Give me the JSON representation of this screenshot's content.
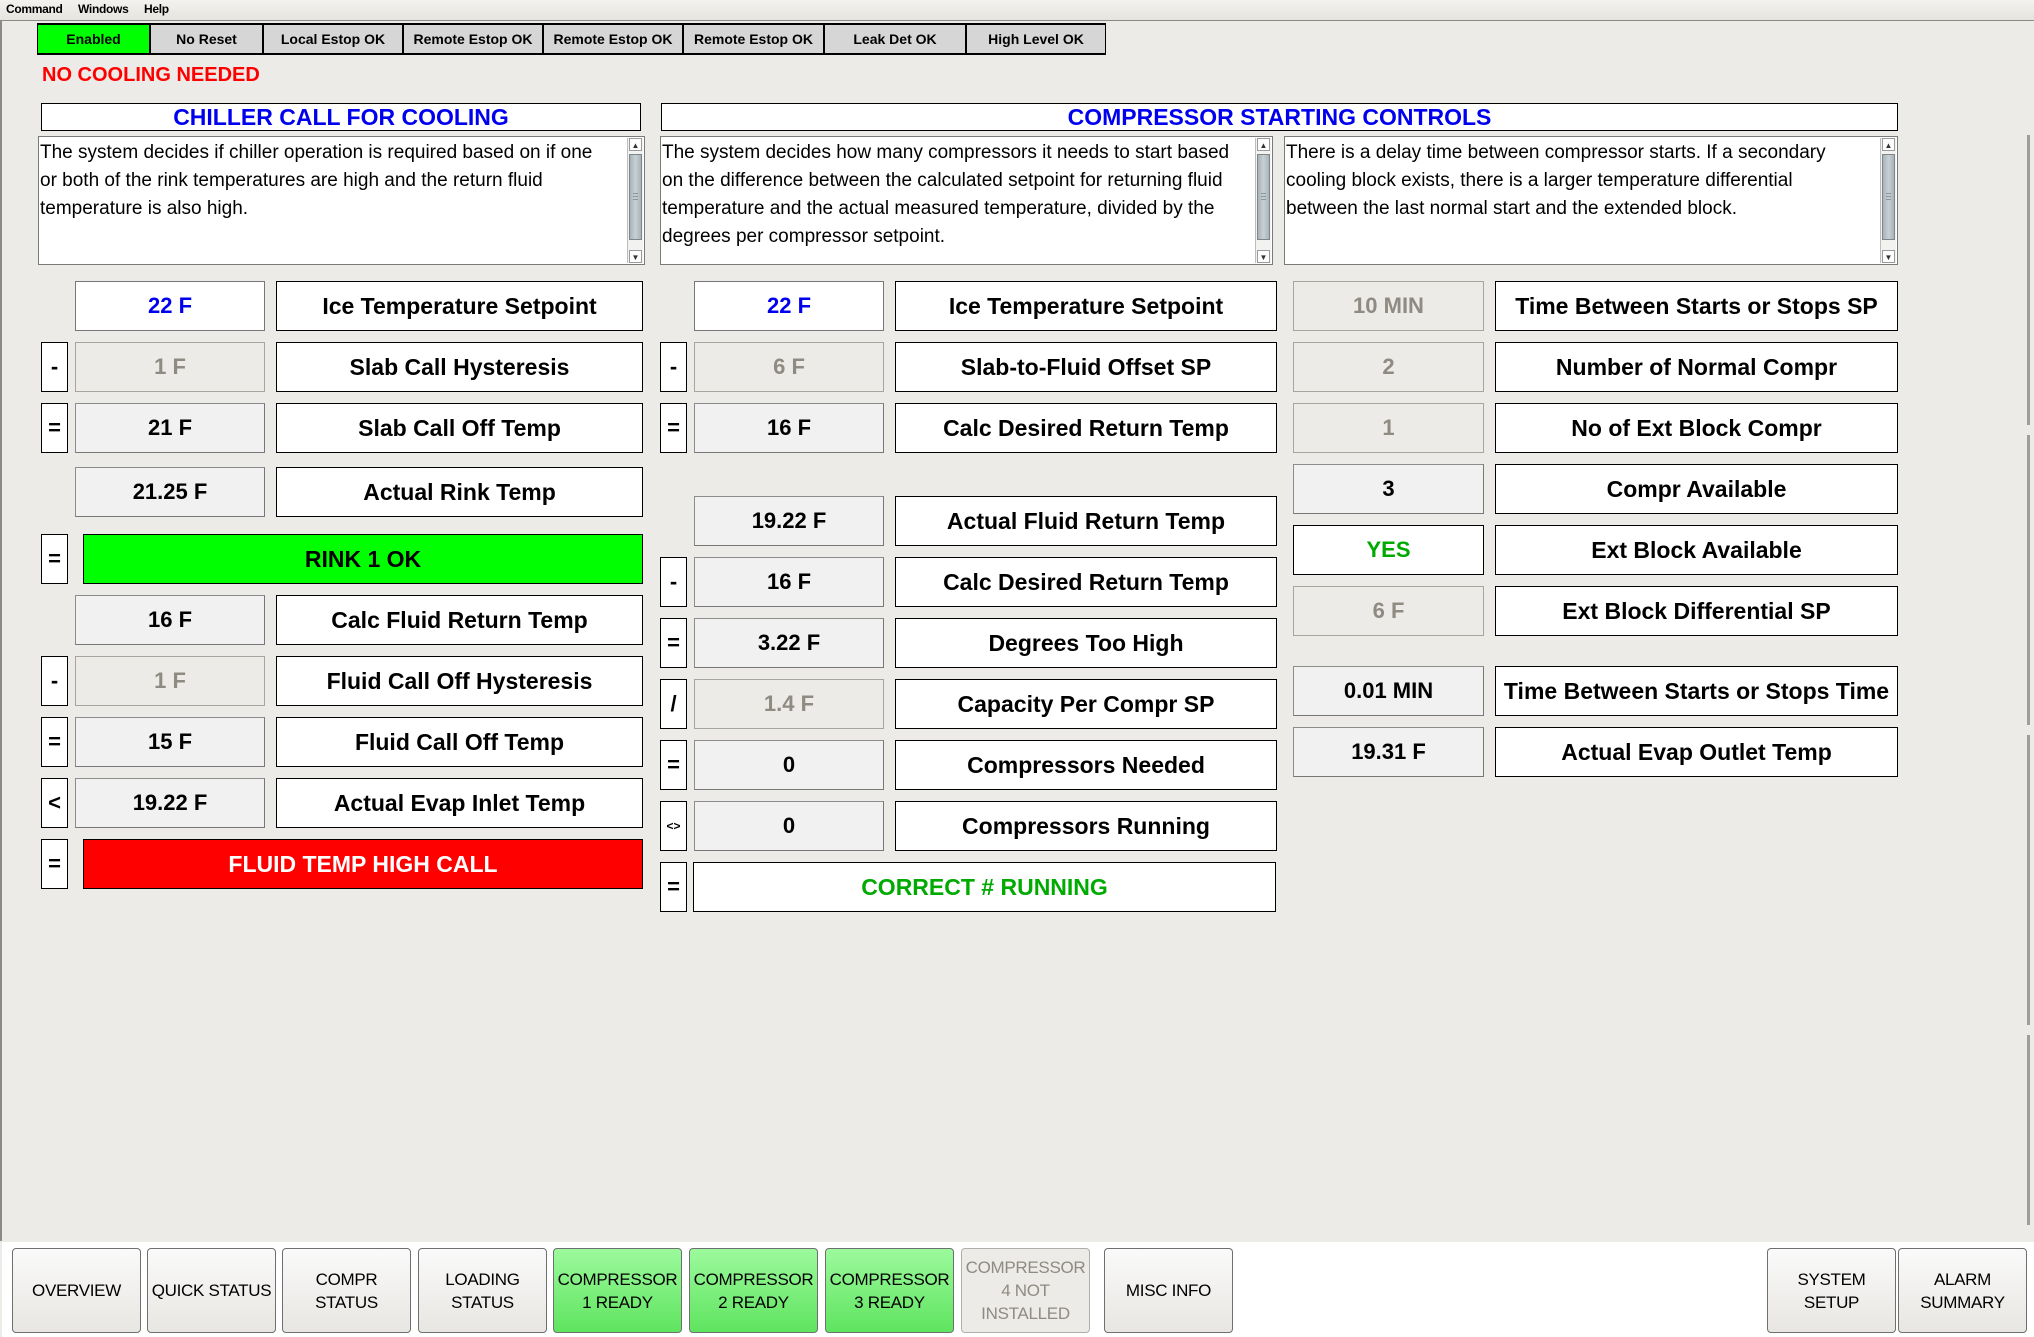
{
  "menu": {
    "items": [
      "Command",
      "Windows",
      "Help"
    ]
  },
  "status_strip": [
    {
      "label": "Enabled",
      "active": true
    },
    {
      "label": "No Reset",
      "active": false
    },
    {
      "label": "Local Estop OK",
      "active": false
    },
    {
      "label": "Remote Estop OK",
      "active": false
    },
    {
      "label": "Remote Estop OK",
      "active": false
    },
    {
      "label": "Remote Estop OK",
      "active": false
    },
    {
      "label": "Leak Det OK",
      "active": false
    },
    {
      "label": "High Level OK",
      "active": false
    }
  ],
  "cooling_status": "NO COOLING NEEDED",
  "sections": {
    "chiller": {
      "title": "CHILLER CALL FOR COOLING",
      "description": "The system decides if chiller operation is required based on if one or both of the rink temperatures are high and the return fluid temperature is also high.",
      "rows": [
        {
          "op": "",
          "value": "22 F",
          "style": "sp",
          "label": "Ice Temperature Setpoint"
        },
        {
          "op": "-",
          "value": "1 F",
          "style": "dim",
          "label": "Slab Call Hysteresis"
        },
        {
          "op": "=",
          "value": "21 F",
          "style": "val",
          "label": "Slab Call Off Temp"
        },
        {
          "op": "",
          "value": "21.25 F",
          "style": "val",
          "label": "Actual Rink Temp"
        }
      ],
      "rink_banner": {
        "op": "=",
        "text": "RINK 1 OK",
        "color": "#00ff00"
      },
      "rows2": [
        {
          "op": "",
          "value": "16 F",
          "style": "val",
          "label": "Calc Fluid Return Temp"
        },
        {
          "op": "-",
          "value": "1 F",
          "style": "dim",
          "label": "Fluid Call Off Hysteresis"
        },
        {
          "op": "=",
          "value": "15 F",
          "style": "val",
          "label": "Fluid Call Off Temp"
        },
        {
          "op": "<",
          "value": "19.22 F",
          "style": "val",
          "label": "Actual Evap Inlet Temp"
        }
      ],
      "fluid_banner": {
        "op": "=",
        "text": "FLUID TEMP HIGH CALL",
        "color": "#ff0000"
      }
    },
    "compressor": {
      "title": "COMPRESSOR STARTING CONTROLS",
      "description_left": "The system decides how many compressors it needs  to start based on the difference between the calculated setpoint for returning fluid temperature and the actual measured temperature,  divided by the degrees per compressor setpoint.",
      "description_right": "There is a delay time between compressor starts. If a secondary cooling block exists, there is a larger temperature differential between the  last normal start and the extended block.",
      "rows_top": [
        {
          "op": "",
          "value": "22 F",
          "style": "sp",
          "label": "Ice Temperature Setpoint"
        },
        {
          "op": "-",
          "value": "6 F",
          "style": "dim",
          "label": "Slab-to-Fluid Offset SP"
        },
        {
          "op": "=",
          "value": "16 F",
          "style": "val",
          "label": "Calc Desired Return Temp"
        }
      ],
      "rows_bottom": [
        {
          "op": "",
          "value": "19.22 F",
          "style": "val",
          "label": "Actual Fluid Return Temp"
        },
        {
          "op": "-",
          "value": "16 F",
          "style": "val",
          "label": "Calc Desired Return Temp"
        },
        {
          "op": "=",
          "value": "3.22 F",
          "style": "val",
          "label": "Degrees Too High"
        },
        {
          "op": "/",
          "value": "1.4 F",
          "style": "dim",
          "label": "Capacity Per Compr SP"
        },
        {
          "op": "=",
          "value": "0",
          "style": "val",
          "label": "Compressors Needed"
        },
        {
          "op": "<>",
          "value": "0",
          "style": "val",
          "label": "Compressors Running"
        }
      ],
      "running_banner": {
        "op": "=",
        "text": "CORRECT # RUNNING",
        "color": "#00aa00"
      },
      "rows_right": [
        {
          "value": "10 MIN",
          "style": "dim",
          "label": "Time Between Starts or Stops SP"
        },
        {
          "value": "2",
          "style": "dim",
          "label": "Number of Normal Compr"
        },
        {
          "value": "1",
          "style": "dim",
          "label": "No of Ext Block Compr"
        },
        {
          "value": "3",
          "style": "val",
          "label": "Compr Available"
        },
        {
          "value": "YES",
          "style": "white",
          "label": "Ext Block Available"
        },
        {
          "value": "6 F",
          "style": "dim",
          "label": "Ext Block Differential SP"
        }
      ],
      "rows_right2": [
        {
          "value": "0.01 MIN",
          "style": "val",
          "label": "Time Between Starts or Stops Time"
        },
        {
          "value": "19.31 F",
          "style": "val",
          "label": "Actual Evap Outlet Temp"
        }
      ]
    }
  },
  "nav": [
    {
      "label": "OVERVIEW",
      "state": "normal"
    },
    {
      "label": "QUICK STATUS",
      "state": "normal"
    },
    {
      "label": "COMPR\nSTATUS",
      "state": "normal"
    },
    {
      "label": "LOADING\nSTATUS",
      "state": "normal"
    },
    {
      "label": "COMPRESSOR\n1 READY",
      "state": "ready"
    },
    {
      "label": "COMPRESSOR\n2 READY",
      "state": "ready"
    },
    {
      "label": "COMPRESSOR\n3 READY",
      "state": "ready"
    },
    {
      "label": "COMPRESSOR\n4 NOT\nINSTALLED",
      "state": "disabled"
    },
    {
      "label": "MISC INFO",
      "state": "normal"
    },
    {
      "label": "SYSTEM SETUP",
      "state": "normal"
    },
    {
      "label": "ALARM\nSUMMARY",
      "state": "normal"
    }
  ],
  "icons": {
    "scroll_up": "▲",
    "scroll_down": "▼"
  }
}
